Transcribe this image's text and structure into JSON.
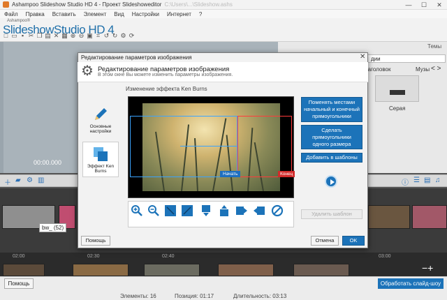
{
  "window": {
    "title": "Ashampoo Slideshow Studio HD 4 - Проект Slideshoweditor",
    "title_blurred": "C:\\Users\\...\\Slideshow.ashs",
    "minimize": "—",
    "maximize": "☐",
    "close": "✕"
  },
  "menu": [
    "Файл",
    "Правка",
    "Вставить",
    "Элемент",
    "Вид",
    "Настройки",
    "Интернет",
    "?"
  ],
  "brand": {
    "small": "Ashampoo®",
    "name": "Slideshow",
    "studio": "Studio HD",
    "version": "4"
  },
  "background": {
    "time": "00:00.000",
    "themes_label": "Темы",
    "dropdown_value": "дии",
    "tab_headings": "заголовок",
    "tab_music": "Музы",
    "arrows": "< >",
    "thumb_label": "Серая",
    "tooltip": "bw_ (52)",
    "ticks": [
      "02:00",
      "02:30",
      "02:40",
      "03:00"
    ],
    "help": "Помощь",
    "process": "Обработать слайд-шоу",
    "status_elements": "Элементы: 16",
    "status_position": "Позиция: 01:17",
    "status_duration": "Длительность: 03:13"
  },
  "dialog": {
    "title": "Редактирование параметров изображения",
    "close": "✕",
    "heading": "Редактирование параметров изображения",
    "subheading": "В этом окне Вы можете изменить параметры изображения.",
    "tabs": {
      "basic": "Основные настройки",
      "kenburns": "Эффект Ken Burns"
    },
    "section_title": "Изменение эффекта Ken Burns",
    "label_start": "Начать",
    "label_end": "Конец",
    "buttons": {
      "swap": "Поменять местами начальный и конечный прямоугольники",
      "same_size": "Сделать прямоугольники одного размера",
      "add_template": "Добавить в шаблоны",
      "delete_template": "Удалить шаблон",
      "help": "Помощь",
      "cancel": "Отмена",
      "ok": "OK"
    },
    "accent": "#1c73b9"
  }
}
